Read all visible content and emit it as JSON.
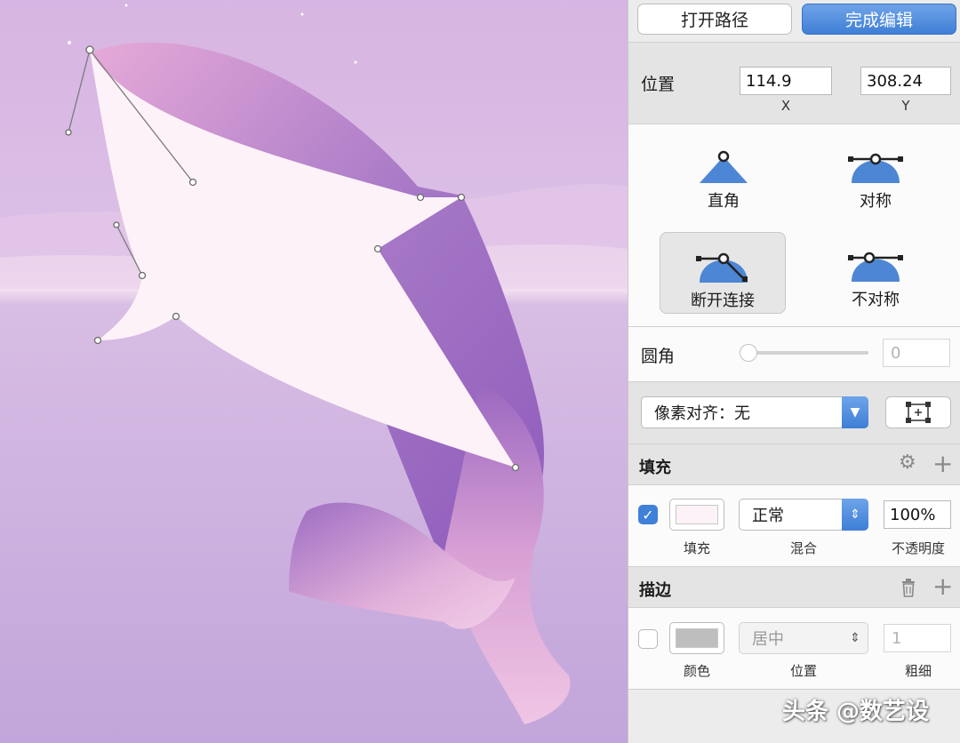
{
  "toolbar": {
    "open_path_label": "打开路径",
    "finish_editing_label": "完成编辑"
  },
  "position": {
    "label": "位置",
    "x_value": "114.9",
    "y_value": "308.24",
    "x_caption": "X",
    "y_caption": "Y"
  },
  "point_types": [
    {
      "label": "直角",
      "selected": false
    },
    {
      "label": "对称",
      "selected": false
    },
    {
      "label": "断开连接",
      "selected": true
    },
    {
      "label": "不对称",
      "selected": false
    }
  ],
  "corner_radius": {
    "label": "圆角",
    "value": "0",
    "slider_fraction": 0
  },
  "pixel_align": {
    "label": "像素对齐：无"
  },
  "fill": {
    "title": "填充",
    "enabled": true,
    "color": "#fdf2f8",
    "blend_mode": "正常",
    "opacity": "100%",
    "captions": {
      "fill": "填充",
      "blend": "混合",
      "opacity": "不透明度"
    }
  },
  "stroke": {
    "title": "描边",
    "enabled": false,
    "color": "#bebebe",
    "position": "居中",
    "width": "1",
    "captions": {
      "color": "颜色",
      "position": "位置",
      "width": "粗细"
    }
  },
  "watermark": "头条 @数艺设",
  "colors": {
    "accent": "#3f80d8",
    "shape_fill": "#fdf2f8",
    "canvas_bg": "#d4b4e4",
    "whale_purple": "#a070c8"
  }
}
